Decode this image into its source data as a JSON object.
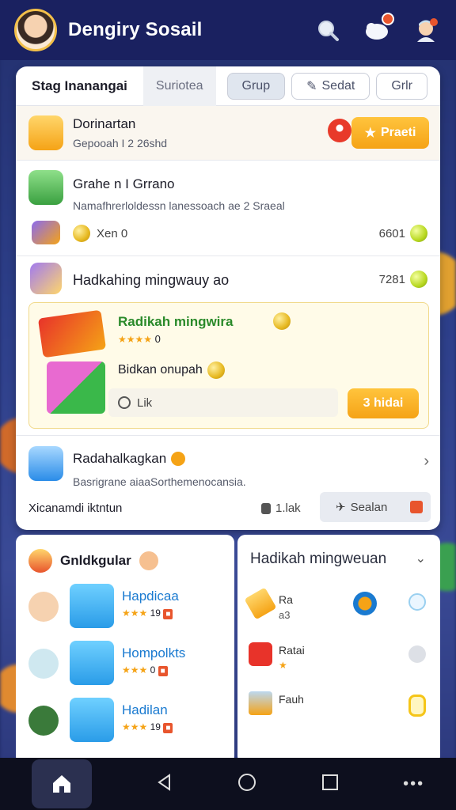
{
  "app": {
    "title": "Dengiry Sosail"
  },
  "tabs": {
    "active": "Stag Inanangai",
    "second": "Surioteа",
    "grup": "Grup",
    "sedat": "Sedat",
    "grlr": "Grlr"
  },
  "featured": {
    "name": "Dorinartan",
    "subtitle": "Gepooah I 2 26shd",
    "button_label": "Praeti"
  },
  "post": {
    "title": "Grahe n⁠ I Grrano",
    "text": "Namafhrerloldessn lanessoach ae 2 Sraeal",
    "reaction_label": "Xen 0",
    "count": "6601"
  },
  "reward": {
    "title": "Hadkahing mingwauy ao",
    "count": "7281",
    "card_title": "Radikah mingwira",
    "card_rating": "0",
    "card_sub": "Bidkan onupah",
    "like_label": "Lik",
    "claim_label": "3 hidai"
  },
  "notice": {
    "title": "Radahalkagkan",
    "text": "Basrigrane aiaaSorthemenocansia.",
    "footer_label": "Xicanamdi iktntun",
    "stat": "1.lak",
    "action_label": "Sealan"
  },
  "bottom_left": {
    "title": "Gnldkgular",
    "items": [
      {
        "name": "Hapdicaa",
        "rating": "19"
      },
      {
        "name": "Hompolkts",
        "rating": "0"
      },
      {
        "name": "Hadilan",
        "rating": "19"
      }
    ]
  },
  "bottom_right": {
    "title": "Hadikah mingweuan",
    "items": [
      {
        "label": "Ra",
        "sub": "a3"
      },
      {
        "label": "Ratai",
        "sub": ""
      },
      {
        "label": "Fauh",
        "sub": ""
      }
    ]
  },
  "colors": {
    "accent": "#f5a316",
    "header": "#1a2160",
    "green_text": "#2a8a2a"
  }
}
